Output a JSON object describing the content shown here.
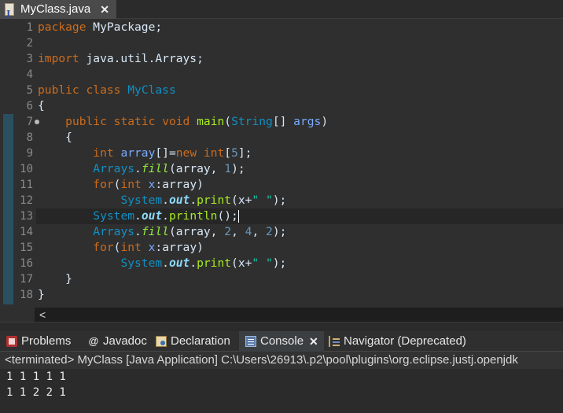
{
  "editor_tab": {
    "title": "MyClass.java"
  },
  "code_lines": [
    {
      "n": "1"
    },
    {
      "n": "2"
    },
    {
      "n": "3"
    },
    {
      "n": "4"
    },
    {
      "n": "5"
    },
    {
      "n": "6"
    },
    {
      "n": "7"
    },
    {
      "n": "8"
    },
    {
      "n": "9"
    },
    {
      "n": "10"
    },
    {
      "n": "11"
    },
    {
      "n": "12"
    },
    {
      "n": "13"
    },
    {
      "n": "14"
    },
    {
      "n": "15"
    },
    {
      "n": "16"
    },
    {
      "n": "17"
    },
    {
      "n": "18"
    }
  ],
  "code": {
    "l1": [
      "package",
      " MyPackage;"
    ],
    "l3": [
      "import",
      " java.util.Arrays;"
    ],
    "l5": [
      "public",
      " ",
      "class",
      " ",
      "MyClass"
    ],
    "l6": "{",
    "l7": [
      "public",
      " ",
      "static",
      " ",
      "void",
      " ",
      "main",
      "(",
      "String",
      "[] ",
      "args",
      ")"
    ],
    "l8": "{",
    "l9": [
      "int",
      " ",
      "array",
      "[]=",
      "new",
      " ",
      "int",
      "[",
      "5",
      "];"
    ],
    "l10": [
      "Arrays",
      ".",
      "fill",
      "(array, ",
      "1",
      ");"
    ],
    "l11": [
      "for",
      "(",
      "int",
      " ",
      "x",
      ":array)"
    ],
    "l12": [
      "System",
      ".",
      "out",
      ".",
      "print",
      "(x+",
      "\" \"",
      ");"
    ],
    "l13": [
      "System",
      ".",
      "out",
      ".",
      "println",
      "();"
    ],
    "l14": [
      "Arrays",
      ".",
      "fill",
      "(array, ",
      "2",
      ", ",
      "4",
      ", ",
      "2",
      ");"
    ],
    "l15": [
      "for",
      "(",
      "int",
      " ",
      "x",
      ":array)"
    ],
    "l16": [
      "System",
      ".",
      "out",
      ".",
      "print",
      "(x+",
      "\" \"",
      ");"
    ],
    "l17": "}",
    "l18": "}"
  },
  "panel_tabs": {
    "problems": "Problems",
    "javadoc": "Javadoc",
    "declaration": "Declaration",
    "console": "Console",
    "navigator": "Navigator (Deprecated)"
  },
  "console": {
    "header": "<terminated> MyClass [Java Application] C:\\Users\\26913\\.p2\\pool\\plugins\\org.eclipse.justj.openjdk",
    "output": [
      "1 1 1 1 1",
      "1 1 2 2 1"
    ]
  },
  "icons": {
    "editor_tab": "java-file-icon",
    "problems": "problems-icon",
    "javadoc": "javadoc-at-icon",
    "declaration": "declaration-icon",
    "console": "console-icon",
    "navigator": "navigator-icon"
  },
  "colors": {
    "keyword": "#cc6c1d",
    "type": "#1290c3",
    "method": "#a7ec21",
    "string": "#17c6a3",
    "number": "#6897bb"
  }
}
